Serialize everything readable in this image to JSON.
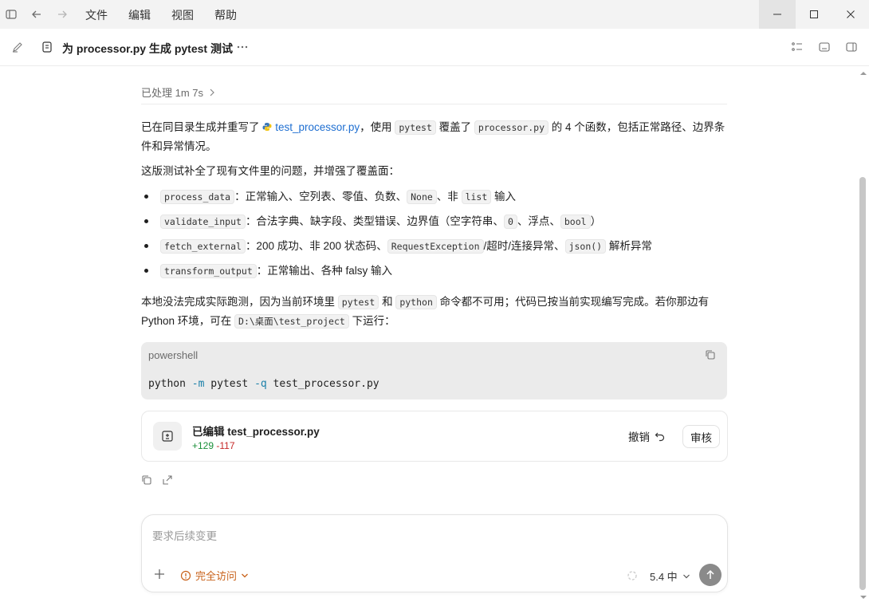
{
  "menu": [
    "文件",
    "编辑",
    "视图",
    "帮助"
  ],
  "header": {
    "title": "为 processor.py 生成 pytest 测试"
  },
  "processed": {
    "label": "已处理 1m 7s"
  },
  "message": {
    "p1": {
      "a": "已在同目录生成并重写了 ",
      "file": "test_processor.py",
      "b": "，使用 ",
      "c1": "pytest",
      "d": " 覆盖了 ",
      "c2": "processor.py",
      "e": " 的 4 个函数，包括正常路径、边界条件和异常情况。"
    },
    "p2": "这版测试补全了现有文件里的问题，并增强了覆盖面：",
    "bullets": [
      {
        "code": "process_data",
        "t1": "：正常输入、空列表、零值、负数、",
        "c1": "None",
        "t2": "、非 ",
        "c2": "list",
        "t3": " 输入"
      },
      {
        "code": "validate_input",
        "t1": "：合法字典、缺字段、类型错误、边界值（空字符串、",
        "c1": "0",
        "t2": "、浮点、",
        "c2": "bool",
        "t3": "）"
      },
      {
        "code": "fetch_external",
        "t1": "：200 成功、非 200 状态码、",
        "c1": "RequestException",
        "t2": "/超时/连接异常、",
        "c2": "json()",
        "t3": " 解析异常"
      },
      {
        "code": "transform_output",
        "t1": "：正常输出、各种 falsy 输入"
      }
    ],
    "p3": {
      "a": "本地没法完成实际跑测，因为当前环境里 ",
      "c1": "pytest",
      "b": " 和 ",
      "c2": "python",
      "c": " 命令都不可用；代码已按当前实现编写完成。若你那边有 Python 环境，可在 ",
      "c3": "D:\\桌面\\test_project",
      "d": " 下运行："
    },
    "codeblock": {
      "lang": "powershell",
      "cmd1": "python ",
      "flag1": "-m",
      "cmd2": " pytest ",
      "flag2": "-q",
      "cmd3": " test_processor.py"
    }
  },
  "edit_card": {
    "title": "已编辑 test_processor.py",
    "added": "+129",
    "removed": "-117",
    "undo": "撤销",
    "review": "审核"
  },
  "composer": {
    "placeholder": "要求后续变更",
    "access": "完全访问",
    "model": "5.4 中"
  },
  "colors": {
    "link": "#1f6fd1",
    "added": "#1a8f3a",
    "removed": "#c62828",
    "access": "#c8621a"
  }
}
